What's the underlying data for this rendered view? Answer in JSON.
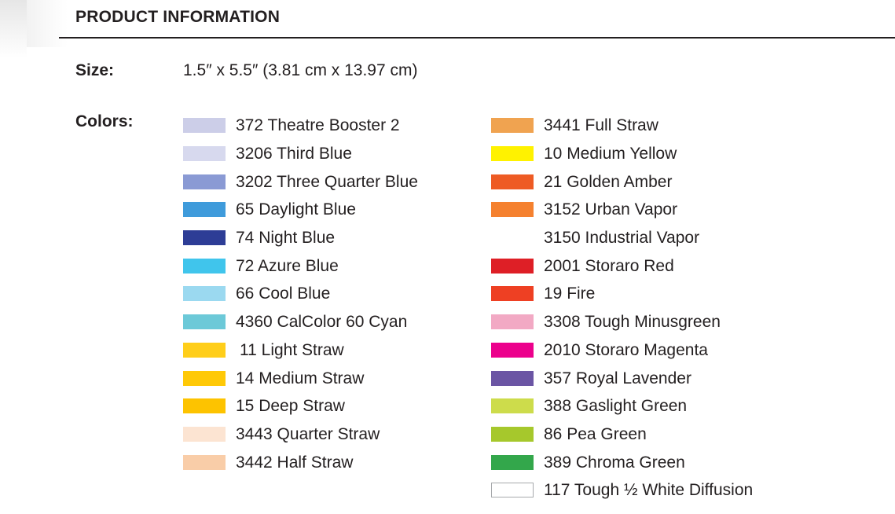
{
  "header": {
    "title": "PRODUCT INFORMATION"
  },
  "specs": {
    "size_label": "Size:",
    "size_value": "1.5″ x 5.5″ (3.81 cm x 13.97 cm)",
    "colors_label": "Colors:"
  },
  "colors": {
    "left_column": [
      {
        "name": "372 Theatre Booster 2",
        "hex": "#CCCEE8"
      },
      {
        "name": "3206 Third Blue",
        "hex": "#D7D9EE"
      },
      {
        "name": "3202 Three Quarter Blue",
        "hex": "#8A9AD4"
      },
      {
        "name": "65 Daylight Blue",
        "hex": "#3F9BDB"
      },
      {
        "name": "74 Night Blue",
        "hex": "#2D3D96"
      },
      {
        "name": "72 Azure Blue",
        "hex": "#40C5EC"
      },
      {
        "name": "66 Cool Blue",
        "hex": "#9BD9F0"
      },
      {
        "name": "4360 CalColor 60 Cyan",
        "hex": "#6CC9D8"
      },
      {
        "name": "11 Light Straw",
        "hex": "#FFCE1A"
      },
      {
        "name": "14 Medium Straw",
        "hex": "#FFC907"
      },
      {
        "name": "15 Deep Straw",
        "hex": "#FDC300"
      },
      {
        "name": "3443 Quarter Straw",
        "hex": "#FCE4D2"
      },
      {
        "name": "3442 Half Straw",
        "hex": "#F9CDA8"
      }
    ],
    "right_column": [
      {
        "name": "3441 Full Straw",
        "hex": "#F0A350"
      },
      {
        "name": "10 Medium Yellow",
        "hex": "#FFF200"
      },
      {
        "name": "21 Golden Amber",
        "hex": "#EE5B24"
      },
      {
        "name": "3152 Urban Vapor",
        "hex": "#F5812F"
      },
      {
        "name": "3150 Industrial Vapor",
        "hex": "#D6D islands"
      },
      {
        "name": "2001 Storaro Red",
        "hex": "#DE1F26"
      },
      {
        "name": "19 Fire",
        "hex": "#EE4023"
      },
      {
        "name": "3308 Tough Minusgreen",
        "hex": "#F2A9C4"
      },
      {
        "name": "2010 Storaro Magenta",
        "hex": "#EC008C"
      },
      {
        "name": "357 Royal Lavender",
        "hex": "#6B55A4"
      },
      {
        "name": "388 Gaslight Green",
        "hex": "#CDDC4B"
      },
      {
        "name": "86 Pea Green",
        "hex": "#A6C82C"
      },
      {
        "name": "389 Chroma Green",
        "hex": "#33A74B"
      },
      {
        "name": "117 Tough ½ White Diffusion",
        "hex": "#FFFFFF",
        "bordered": true
      }
    ]
  }
}
